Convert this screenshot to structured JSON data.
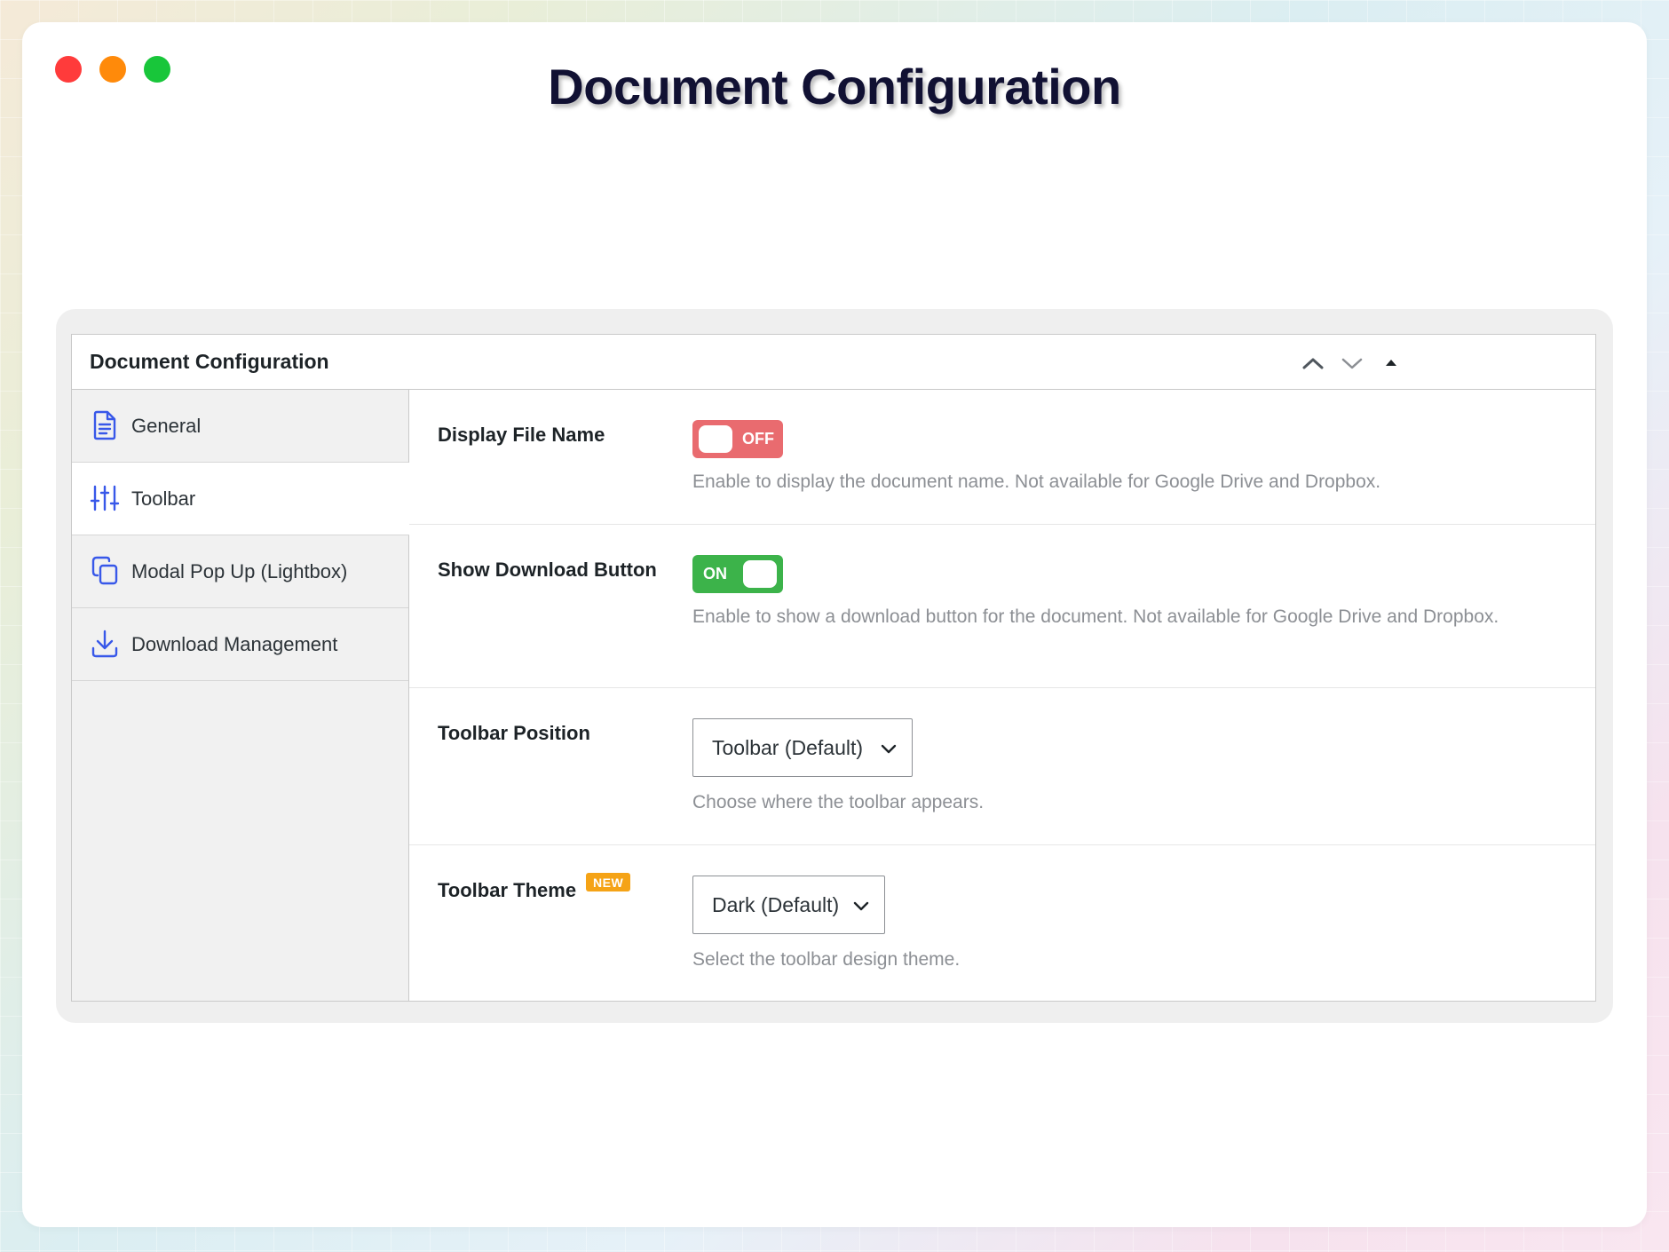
{
  "window": {
    "title": "Document Configuration",
    "controls": [
      "close",
      "minimize",
      "maximize"
    ]
  },
  "panel": {
    "title": "Document Configuration",
    "header_controls": [
      "chevron-up-icon",
      "chevron-down-icon",
      "triangle-up-icon"
    ]
  },
  "sidebar": {
    "items": [
      {
        "label": "General",
        "icon": "document-icon",
        "active": false
      },
      {
        "label": "Toolbar",
        "icon": "sliders-icon",
        "active": true
      },
      {
        "label": "Modal Pop Up (Lightbox)",
        "icon": "copy-icon",
        "active": false
      },
      {
        "label": "Download Management",
        "icon": "download-icon",
        "active": false
      }
    ]
  },
  "settings": {
    "display_file_name": {
      "label": "Display File Name",
      "toggle_state": "OFF",
      "description": "Enable to display the document name. Not available for Google Drive and Dropbox."
    },
    "show_download_button": {
      "label": "Show Download Button",
      "toggle_state": "ON",
      "description": "Enable to show a download button for the document. Not available for Google Drive and Dropbox."
    },
    "toolbar_position": {
      "label": "Toolbar Position",
      "selected": "Toolbar (Default)",
      "description": "Choose where the toolbar appears."
    },
    "toolbar_theme": {
      "label": "Toolbar Theme",
      "badge": "NEW",
      "selected": "Dark (Default)",
      "description": "Select the toolbar design theme."
    }
  },
  "colors": {
    "accent": "#3858e9",
    "toggle_off": "#e96b6f",
    "toggle_on": "#3cb34a",
    "badge": "#f5a316"
  }
}
